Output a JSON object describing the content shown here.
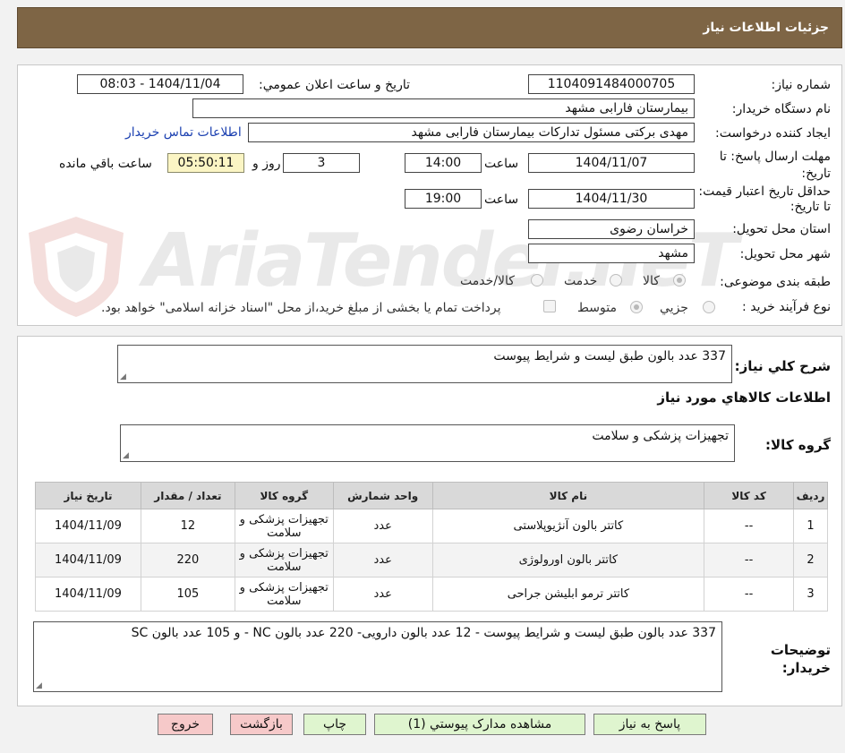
{
  "header": {
    "title": "جزئیات اطلاعات نیاز"
  },
  "form": {
    "need_number_label": "شماره نیاز:",
    "need_number": "1104091484000705",
    "announce_label": "تاریخ و ساعت اعلان عمومي:",
    "announce_value": "1404/11/04 - 08:03",
    "buyer_org_label": "نام دستگاه خریدار:",
    "buyer_org": "بیمارستان فارابی مشهد",
    "requester_label": "ایجاد کننده درخواست:",
    "requester": "مهدی برکتی مسئول تدارکات بیمارستان فارابی مشهد",
    "contact_link": "اطلاعات تماس خریدار",
    "deadline_label": "مهلت ارسال پاسخ: تا تاریخ:",
    "deadline_date": "1404/11/07",
    "time_label": "ساعت",
    "deadline_time": "14:00",
    "days": "3",
    "days_label": "روز و",
    "remaining_time": "05:50:11",
    "remaining_label": "ساعت باقي مانده",
    "validity_label": "حداقل تاریخ اعتبار قیمت: تا تاریخ:",
    "validity_date": "1404/11/30",
    "validity_time": "19:00",
    "province_label": "استان محل تحویل:",
    "province": "خراسان رضوی",
    "city_label": "شهر محل تحویل:",
    "city": "مشهد",
    "category_label": "طبقه بندی موضوعی:",
    "category_options": [
      "کالا",
      "خدمت",
      "کالا/خدمت"
    ],
    "process_label": "نوع فرآیند خرید :",
    "process_options": [
      "جزیي",
      "متوسط"
    ],
    "payment_note": "پرداخت تمام یا بخشی از مبلغ خرید،از محل \"اسناد خزانه اسلامی\" خواهد بود."
  },
  "summary": {
    "label": "شرح کلي نیاز:",
    "value": "337 عدد بالون طبق لیست و شرایط پیوست"
  },
  "goods": {
    "section_title": "اطلاعات کالاهاي مورد نیاز",
    "group_label": "گروه کالا:",
    "group_value": "تجهیزات پزشکی و سلامت",
    "columns": [
      "ردیف",
      "کد کالا",
      "نام کالا",
      "واحد شمارش",
      "گروه کالا",
      "تعداد / مقدار",
      "تاریخ نیاز"
    ],
    "rows": [
      [
        "1",
        "--",
        "کاتتر بالون آنژیوپلاستی",
        "عدد",
        "تجهیزات پزشکی و سلامت",
        "12",
        "1404/11/09"
      ],
      [
        "2",
        "--",
        "کاتتر بالون اورولوژی",
        "عدد",
        "تجهیزات پزشکی و سلامت",
        "220",
        "1404/11/09"
      ],
      [
        "3",
        "--",
        "کاتتر ترمو ابلیشن جراحی",
        "عدد",
        "تجهیزات پزشکی و سلامت",
        "105",
        "1404/11/09"
      ]
    ]
  },
  "notes": {
    "label": "توضیحات خریدار:",
    "value": "337 عدد بالون طبق لیست و شرایط پیوست - 12 عدد بالون دارویی- 220 عدد بالون NC - و 105 عدد بالون SC"
  },
  "buttons": {
    "reply": "پاسخ به نیاز",
    "attachments": "مشاهده مدارک پیوستي (1)",
    "print": "چاپ",
    "back": "بازگشت",
    "exit": "خروج"
  },
  "watermark": {
    "text": "AriaTender.neT"
  },
  "colors": {
    "header_bg": "#7e6545",
    "link": "#1a3fb0",
    "button_green": "#dff5cf",
    "button_pink": "#f6c9c9",
    "remaining_bg": "#fbf5c4"
  }
}
